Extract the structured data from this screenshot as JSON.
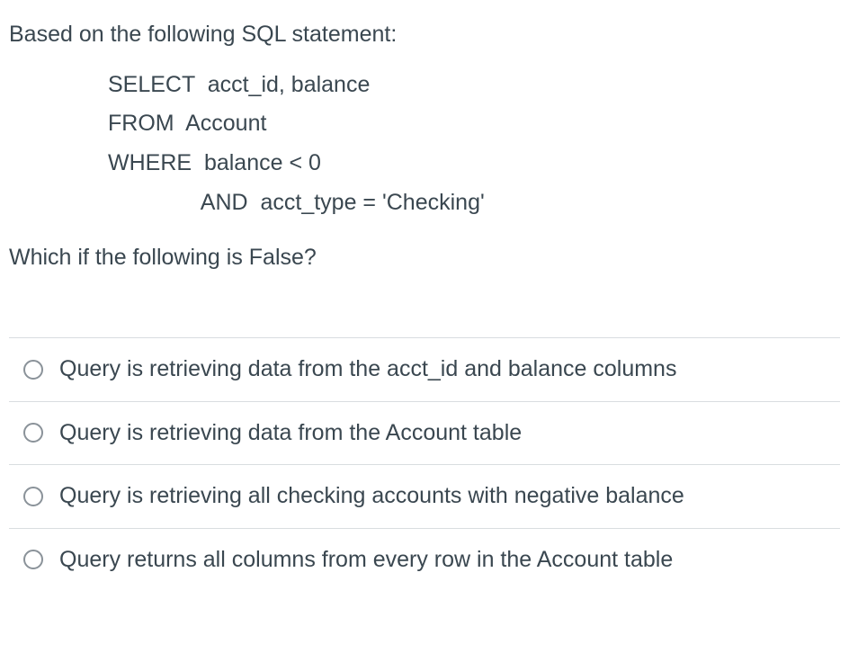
{
  "question": {
    "intro": "Based on the following SQL statement:",
    "sql": {
      "line1": "SELECT  acct_id, balance",
      "line2": "FROM  Account",
      "line3": "WHERE  balance < 0",
      "line4": "               AND  acct_type = 'Checking'"
    },
    "prompt": "Which if the following is False?"
  },
  "options": [
    {
      "text": "Query is retrieving data from the acct_id and balance columns"
    },
    {
      "text": "Query is retrieving data from the Account table"
    },
    {
      "text": "Query is retrieving all checking accounts with negative balance"
    },
    {
      "text": "Query returns all columns from every row in the Account table"
    }
  ]
}
